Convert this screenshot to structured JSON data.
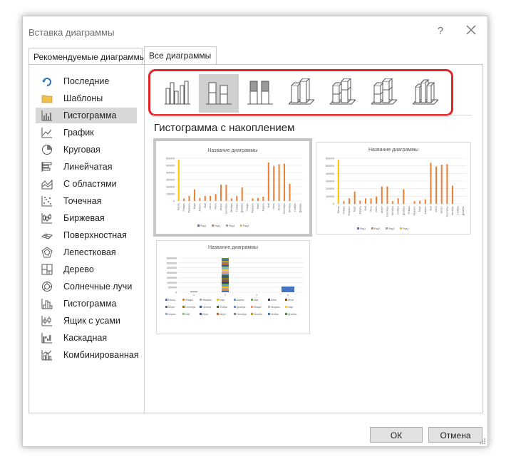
{
  "window": {
    "title": "Вставка диаграммы",
    "help_label": "?"
  },
  "tabs": [
    {
      "label": "Рекомендуемые диаграммы",
      "active": false
    },
    {
      "label": "Все диаграммы",
      "active": true
    }
  ],
  "categories": [
    {
      "label": "Последние",
      "icon": "recent-icon",
      "selected": false
    },
    {
      "label": "Шаблоны",
      "icon": "folder-icon",
      "selected": false
    },
    {
      "label": "Гистограмма",
      "icon": "column-chart-icon",
      "selected": true
    },
    {
      "label": "График",
      "icon": "line-chart-icon",
      "selected": false
    },
    {
      "label": "Круговая",
      "icon": "pie-chart-icon",
      "selected": false
    },
    {
      "label": "Линейчатая",
      "icon": "bar-chart-icon",
      "selected": false
    },
    {
      "label": "С областями",
      "icon": "area-chart-icon",
      "selected": false
    },
    {
      "label": "Точечная",
      "icon": "scatter-chart-icon",
      "selected": false
    },
    {
      "label": "Биржевая",
      "icon": "stock-chart-icon",
      "selected": false
    },
    {
      "label": "Поверхностная",
      "icon": "surface-chart-icon",
      "selected": false
    },
    {
      "label": "Лепестковая",
      "icon": "radar-chart-icon",
      "selected": false
    },
    {
      "label": "Дерево",
      "icon": "treemap-chart-icon",
      "selected": false
    },
    {
      "label": "Солнечные лучи",
      "icon": "sunburst-chart-icon",
      "selected": false
    },
    {
      "label": "Гистограмма",
      "icon": "histogram-chart-icon",
      "selected": false
    },
    {
      "label": "Ящик с усами",
      "icon": "box-whisker-chart-icon",
      "selected": false
    },
    {
      "label": "Каскадная",
      "icon": "waterfall-chart-icon",
      "selected": false
    },
    {
      "label": "Комбинированная",
      "icon": "combo-chart-icon",
      "selected": false
    }
  ],
  "subtypes": [
    {
      "icon": "clustered-column-icon",
      "selected": false
    },
    {
      "icon": "stacked-column-icon",
      "selected": true
    },
    {
      "icon": "stacked-100-column-icon",
      "selected": false
    },
    {
      "icon": "3d-clustered-column-icon",
      "selected": false
    },
    {
      "icon": "3d-stacked-column-icon",
      "selected": false
    },
    {
      "icon": "3d-stacked-100-column-icon",
      "selected": false
    },
    {
      "icon": "3d-column-icon",
      "selected": false
    }
  ],
  "section_title": "Гистограмма с накоплением",
  "previews": {
    "chart_title": "Название диаграммы",
    "months": [
      "Месяц",
      "Январь",
      "Февраль",
      "Март",
      "Апрель",
      "Май",
      "Июнь",
      "Июль",
      "Август",
      "Сентябрь",
      "Октябрь",
      "Ноябрь",
      "Декабрь",
      "Январь",
      "Февраль",
      "Март",
      "Апрель",
      "Май",
      "Июнь",
      "Август",
      "Сентябрь",
      "Октябрь",
      "Ноябрь",
      "Декабрь"
    ],
    "y_ticks": [
      "600000",
      "500000",
      "400000",
      "300000",
      "200000",
      "100000",
      "0"
    ],
    "legend": [
      "Ряд1",
      "Ряд2",
      "Ряд3",
      "Ряд4"
    ],
    "series_colors": [
      "#4472c4",
      "#ed7d31",
      "#a5a5a5",
      "#ffc000"
    ],
    "third_y_ticks": [
      "6000000",
      "5000000",
      "4000000",
      "3000000",
      "2000000",
      "1000000",
      "500000",
      "0"
    ],
    "third_x": [
      "1",
      "2",
      "3",
      "4"
    ],
    "third_legend": [
      "Месяц",
      "Январь",
      "Февраль",
      "Март",
      "Апрель",
      "Май",
      "Июнь",
      "Июль",
      "Август",
      "Сентябрь",
      "Октябрь",
      "Ноябрь",
      "Декабрь",
      "Январь",
      "Февраль",
      "Март",
      "Апрель",
      "Май",
      "Июнь",
      "Август",
      "Сентябрь",
      "Октябрь",
      "Ноябрь",
      "Декабрь"
    ]
  },
  "buttons": {
    "ok": "ОК",
    "cancel": "Отмена"
  },
  "colors": {
    "highlight_border": "#e3252a",
    "selected_bg": "#d8d8d8"
  }
}
